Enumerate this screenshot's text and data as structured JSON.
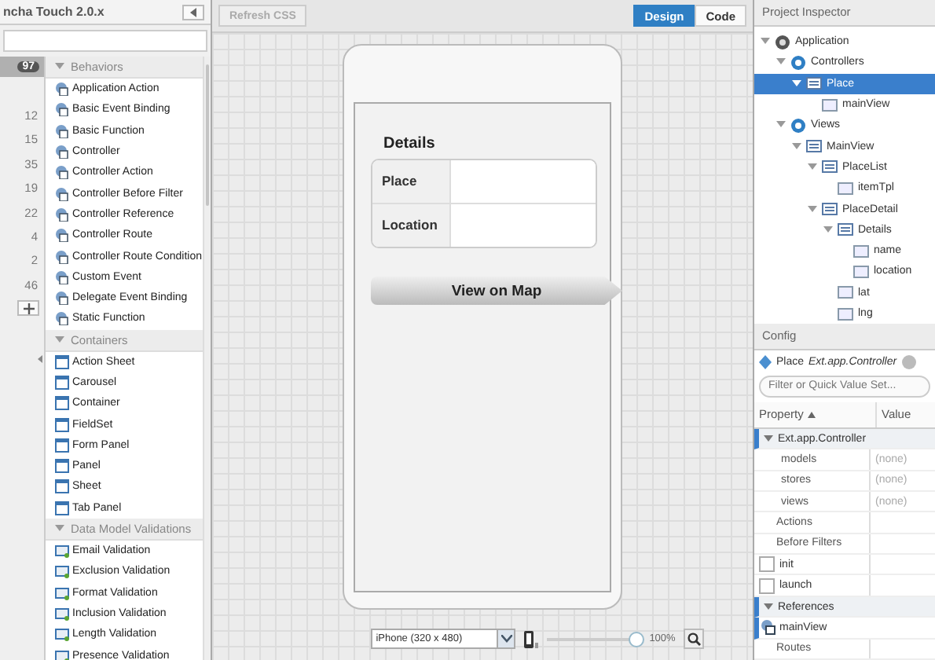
{
  "library": {
    "title": "ncha Touch 2.0.x",
    "badge": "97",
    "counts": [
      "12",
      "15",
      "35",
      "19",
      "22",
      "4",
      "2",
      "46"
    ],
    "sections": [
      {
        "title": "Behaviors",
        "expanded": true,
        "items": [
          "Application Action",
          "Basic Event Binding",
          "Basic Function",
          "Controller",
          "Controller Action",
          "Controller Before Filter",
          "Controller Reference",
          "Controller Route",
          "Controller Route Condition",
          "Custom Event",
          "Delegate Event Binding",
          "Static Function"
        ]
      },
      {
        "title": "Containers",
        "expanded": true,
        "items": [
          "Action Sheet",
          "Carousel",
          "Container",
          "FieldSet",
          "Form Panel",
          "Panel",
          "Sheet",
          "Tab Panel"
        ]
      },
      {
        "title": "Data Model Validations",
        "expanded": true,
        "items": [
          "Email Validation",
          "Exclusion Validation",
          "Format Validation",
          "Inclusion Validation",
          "Length Validation",
          "Presence Validation"
        ]
      }
    ]
  },
  "canvas": {
    "refresh": {
      "label": "Refresh CSS",
      "disabled": true
    },
    "modes": [
      {
        "label": "Design",
        "selected": true
      },
      {
        "label": "Code",
        "selected": false
      }
    ],
    "form": {
      "title": "Details",
      "fields": [
        "Place",
        "Location"
      ],
      "button": "View on Map"
    },
    "device": {
      "value": "iPhone (320 x 480)"
    },
    "zoom": {
      "level": 0.95,
      "reading": "100%"
    }
  },
  "inspector": {
    "title": "Project Inspector",
    "tree": [
      {
        "label": "Application",
        "selected": false,
        "expanded": true,
        "children": [
          {
            "label": "Controllers",
            "selected": false,
            "expanded": true,
            "children": [
              {
                "label": "Place",
                "selected": true,
                "expanded": true,
                "children": [
                  {
                    "label": "mainView",
                    "selected": false
                  }
                ]
              }
            ]
          },
          {
            "label": "Views",
            "selected": false,
            "expanded": true,
            "children": [
              {
                "label": "MainView",
                "selected": false,
                "expanded": true,
                "children": [
                  {
                    "label": "PlaceList",
                    "selected": false,
                    "expanded": true,
                    "children": [
                      {
                        "label": "itemTpl",
                        "selected": false
                      }
                    ]
                  },
                  {
                    "label": "PlaceDetail",
                    "selected": false,
                    "expanded": true,
                    "children": [
                      {
                        "label": "Details",
                        "selected": false,
                        "expanded": true,
                        "children": [
                          {
                            "label": "name",
                            "selected": false
                          },
                          {
                            "label": "location",
                            "selected": false
                          }
                        ]
                      },
                      {
                        "label": "lat",
                        "selected": false
                      },
                      {
                        "label": "lng",
                        "selected": false
                      }
                    ]
                  }
                ]
              }
            ]
          }
        ]
      }
    ]
  },
  "config": {
    "title": "Config",
    "object": "Place",
    "class": "Ext.app.Controller",
    "placeholder": "Filter or Quick Value Set...",
    "columns": [
      "Property",
      "Value"
    ],
    "rows": [
      {
        "kind": "group",
        "label": "Ext.app.Controller",
        "expanded": true
      },
      {
        "kind": "prop",
        "label": "models",
        "value": "(none)"
      },
      {
        "kind": "prop",
        "label": "stores",
        "value": "(none)"
      },
      {
        "kind": "prop",
        "label": "views",
        "value": "(none)"
      },
      {
        "kind": "heading",
        "label": "Actions"
      },
      {
        "kind": "heading",
        "label": "Before Filters"
      },
      {
        "kind": "check",
        "label": "init",
        "checked": false
      },
      {
        "kind": "check",
        "label": "launch",
        "checked": false
      },
      {
        "kind": "group",
        "label": "References",
        "expanded": true
      },
      {
        "kind": "ref",
        "label": "mainView"
      },
      {
        "kind": "heading",
        "label": "Routes"
      }
    ]
  }
}
